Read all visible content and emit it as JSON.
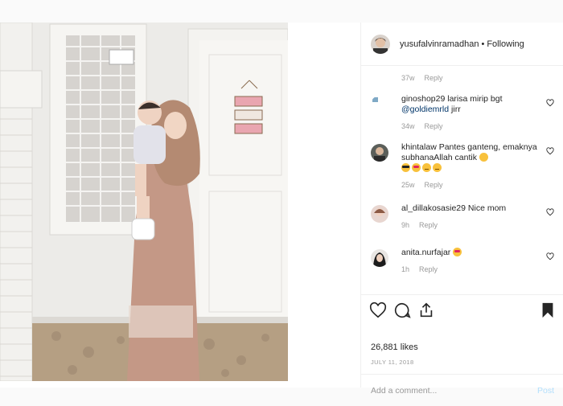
{
  "header": {
    "username": "yusufalvinramadhan",
    "separator": "•",
    "follow_status": "Following"
  },
  "top_meta": {
    "time": "37w",
    "reply": "Reply"
  },
  "comments": [
    {
      "username": "ginoshop29",
      "text": "larisa mirip bgt",
      "mention": "@goldiemrld",
      "tail": "jirr",
      "time": "34w",
      "reply": "Reply",
      "avatar_alt": "gino's n"
    },
    {
      "username": "khintalaw",
      "text": "Pantes ganteng, emaknya subhanaAllah cantik",
      "time": "25w",
      "reply": "Reply",
      "emoji": [
        "smiling-face-emoji",
        "heart-eyes-emoji",
        "smiling-face-emoji",
        "heart-eyes-emoji"
      ]
    },
    {
      "username": "al_dillakosasie29",
      "text": "Nice mom",
      "time": "9h",
      "reply": "Reply"
    },
    {
      "username": "anita.nurfajar",
      "text": "",
      "time": "1h",
      "reply": "Reply",
      "emoji": [
        "heart-eyes-emoji"
      ]
    }
  ],
  "actions": {
    "likes": "26,881 likes",
    "date": "JULY 11, 2018"
  },
  "add_comment": {
    "placeholder": "Add a comment...",
    "post_label": "Post"
  },
  "colors": {
    "text": "#262626",
    "muted": "#999999",
    "link": "#003569",
    "post_disabled": "#b2dffc",
    "border": "#efefef"
  }
}
